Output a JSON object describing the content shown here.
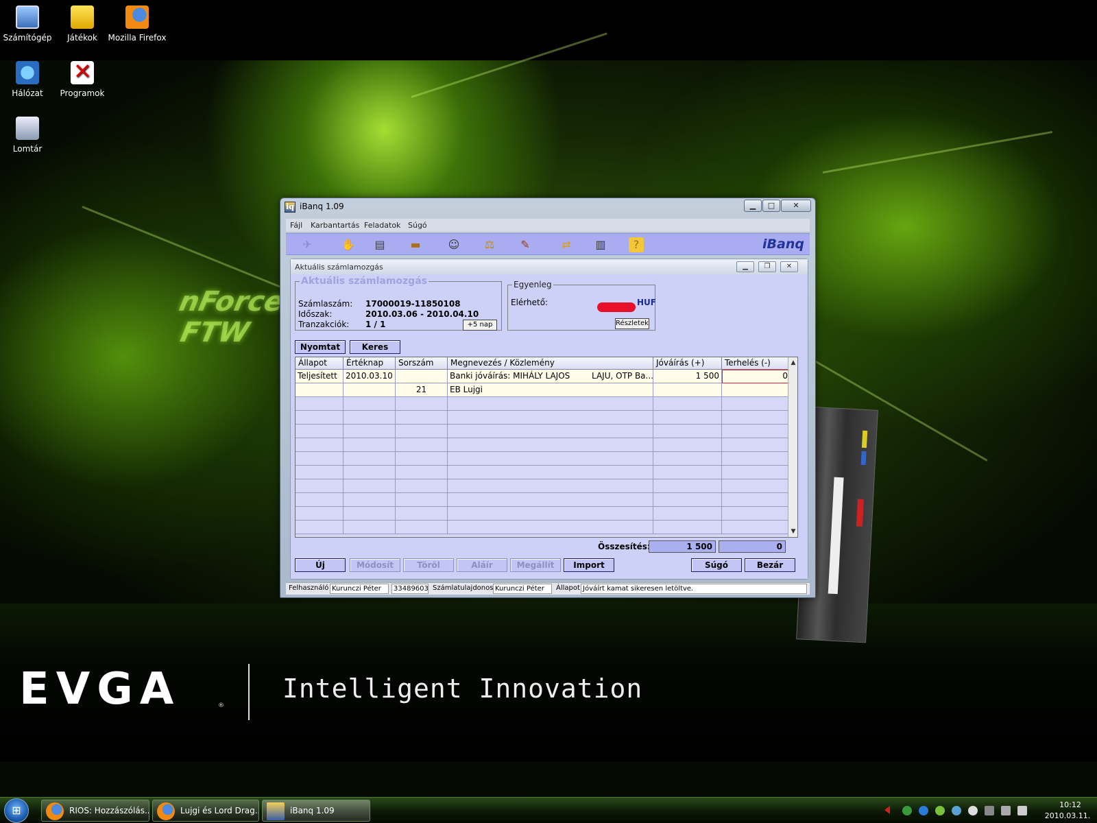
{
  "desktop": {
    "icons": [
      {
        "label": "Számítógép",
        "icon": "computer-icon"
      },
      {
        "label": "Játékok",
        "icon": "games-icon"
      },
      {
        "label": "Mozilla Firefox",
        "icon": "firefox-icon"
      },
      {
        "label": "Hálózat",
        "icon": "network-icon"
      },
      {
        "label": "Programok",
        "icon": "programs-icon"
      },
      {
        "label": "Lomtár",
        "icon": "recycle-bin-icon"
      }
    ],
    "wallpaper": {
      "brand": "EVGA",
      "tagline": "Intelligent Innovation",
      "overlay_text_1": "nForce",
      "overlay_text_2": "FTW"
    }
  },
  "window": {
    "title": "iBanq 1.09",
    "menu": [
      "Fájl",
      "Karbantartás",
      "Feladatok",
      "Súgó"
    ],
    "toolbar_logo": "iBanq",
    "toolbar_icons": [
      "bird-icon",
      "cash-icon",
      "document-icon",
      "card-icon",
      "people-icon",
      "scales-icon",
      "contacts-icon",
      "transfer-icon",
      "book-icon",
      "help-icon"
    ]
  },
  "child": {
    "title": "Aktuális számlamozgás",
    "account_group": {
      "legend": "Aktuális számlamozgás",
      "account_label": "Számlaszám:",
      "account_value": "17000019-11850108",
      "period_label": "Időszak:",
      "period_value": "2010.03.06 - 2010.04.10",
      "transactions_label": "Tranzakciók:",
      "transactions_value": "1 / 1",
      "plus_days_button": "+5 nap"
    },
    "balance_group": {
      "legend": "Egyenleg",
      "available_label": "Elérhető:",
      "currency": "HUF",
      "details_button": "Részletek"
    },
    "actions": {
      "print": "Nyomtat",
      "search": "Keres"
    },
    "grid": {
      "columns": [
        "Állapot",
        "Értéknap",
        "Sorszám",
        "Megnevezés / Közlemény",
        "Jóváírás (+)",
        "Terhelés (-)"
      ],
      "rows": [
        {
          "status": "Teljesített",
          "value_date": "2010.03.10",
          "serial": "",
          "description": "Banki jóváírás: MIHÁLY LAJOS",
          "description_extra": "LAJU, OTP Ba...",
          "credit": "1 500",
          "debit": "0"
        },
        {
          "status": "",
          "value_date": "",
          "serial": "21",
          "description": "EB Lujgi",
          "description_extra": "",
          "credit": "",
          "debit": ""
        }
      ]
    },
    "totals": {
      "label": "Összesítés:",
      "credit": "1 500",
      "debit": "0"
    },
    "bottom_buttons": {
      "new": "Új",
      "modify": "Módosít",
      "delete": "Töröl",
      "sign": "Aláír",
      "stop": "Megállít",
      "import": "Import",
      "help": "Súgó",
      "close": "Bezár"
    }
  },
  "statusbar": {
    "user_label": "Felhasználó",
    "user_name": "Kurunczi Péter",
    "user_id": "33489603",
    "owner_label": "Számlatulajdonos",
    "owner_name": "Kurunczi Péter",
    "state_label": "Állapot",
    "state_value": "Jóváírt kamat sikeresen letöltve."
  },
  "taskbar": {
    "buttons": [
      {
        "label": "RIOS: Hozzászólás...",
        "icon": "firefox-icon"
      },
      {
        "label": "Lujgi és Lord Drag...",
        "icon": "firefox-icon"
      },
      {
        "label": "iBanq 1.09",
        "icon": "ibanq-icon"
      }
    ],
    "clock_time": "10:12",
    "clock_date": "2010.03.11."
  }
}
